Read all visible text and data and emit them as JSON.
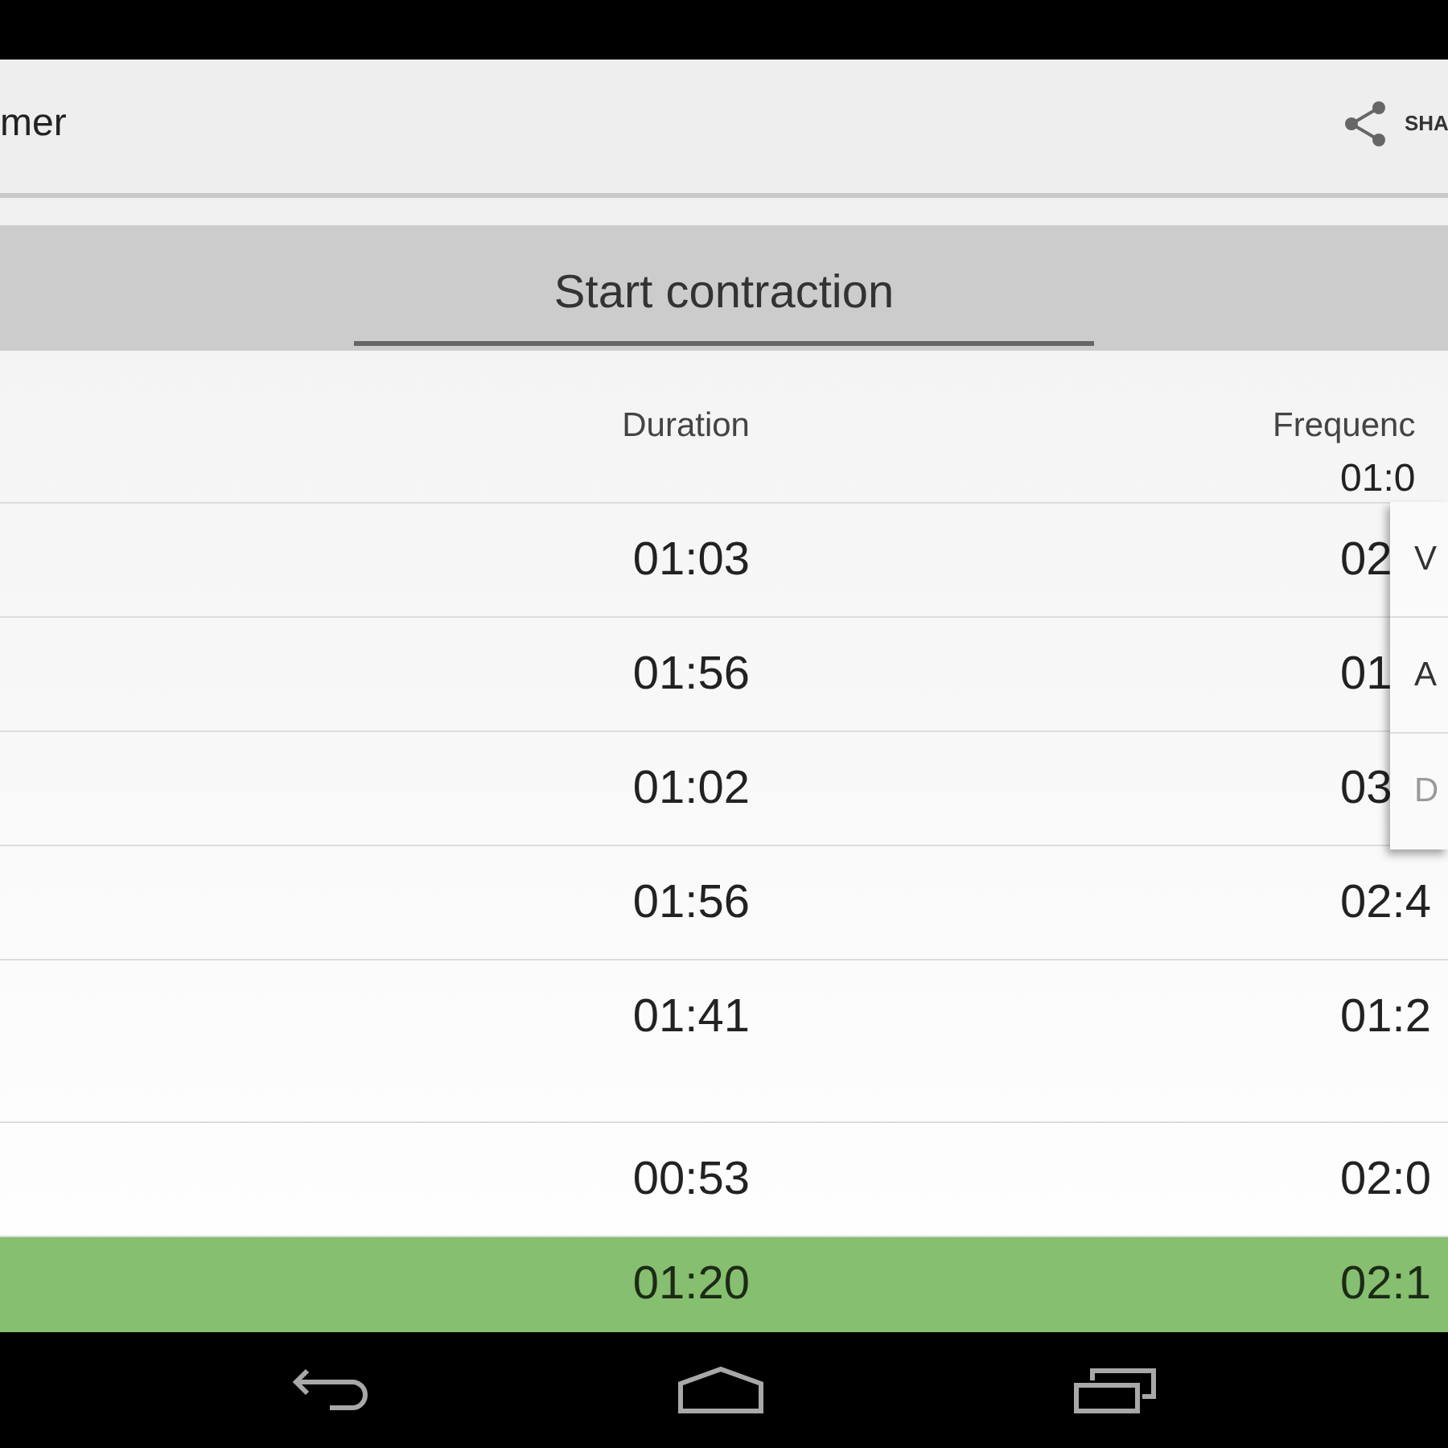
{
  "action_bar": {
    "title": "mer",
    "share_label": "SHA"
  },
  "start_button": {
    "label": "Start contraction"
  },
  "table": {
    "columns": [
      "Duration",
      "Frequenc"
    ],
    "partial_row": {
      "frequency": "01:0"
    },
    "rows": [
      {
        "duration": "01:03",
        "frequency": "02",
        "selected": false
      },
      {
        "duration": "01:56",
        "frequency": "01",
        "selected": false
      },
      {
        "duration": "01:02",
        "frequency": "03",
        "selected": false
      },
      {
        "duration": "01:56",
        "frequency": "02:4",
        "selected": false
      },
      {
        "duration": "01:41",
        "frequency": "01:2",
        "selected": false
      },
      {
        "duration": "00:53",
        "frequency": "02:0",
        "selected": false
      },
      {
        "duration": "01:20",
        "frequency": "02:1",
        "selected": true
      }
    ]
  },
  "popup_menu": {
    "items": [
      {
        "label": "V",
        "disabled": false
      },
      {
        "label": "A",
        "disabled": false
      },
      {
        "label": "D",
        "disabled": true
      }
    ]
  }
}
